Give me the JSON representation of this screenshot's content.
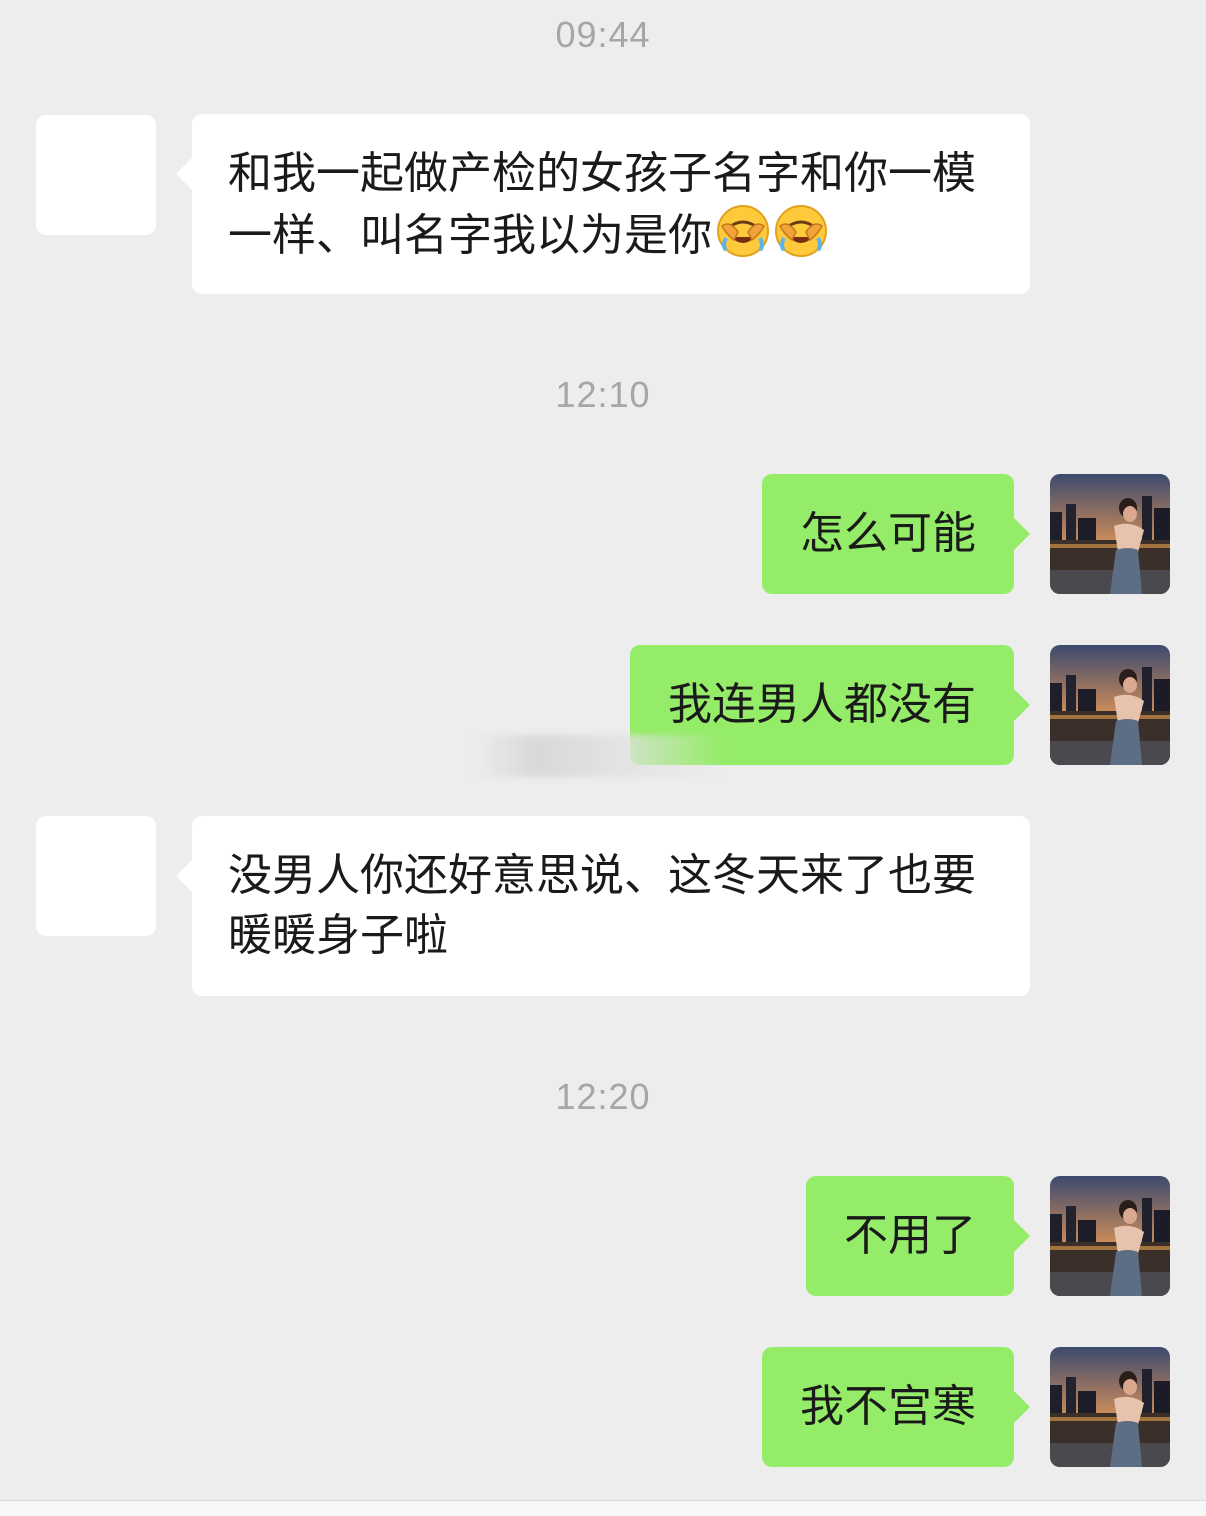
{
  "chat": {
    "messages": [
      {
        "type": "time",
        "text": "09:44"
      },
      {
        "type": "in",
        "text": "和我一起做产检的女孩子名字和你一模一样、叫名字我以为是你",
        "emoji": [
          "facepalm-laugh-emoji",
          "facepalm-laugh-emoji"
        ]
      },
      {
        "type": "time",
        "text": "12:10"
      },
      {
        "type": "out",
        "text": "怎么可能"
      },
      {
        "type": "out",
        "text": "我连男人都没有"
      },
      {
        "type": "in",
        "text": "没男人你还好意思说、这冬天来了也要暖暖身子啦"
      },
      {
        "type": "time",
        "text": "12:20"
      },
      {
        "type": "out",
        "text": "不用了"
      },
      {
        "type": "out",
        "text": "我不宫寒"
      }
    ]
  },
  "colors": {
    "background": "#ededed",
    "incoming_bubble": "#ffffff",
    "outgoing_bubble": "#95ec69",
    "timestamp_text": "#a6a6a6"
  }
}
